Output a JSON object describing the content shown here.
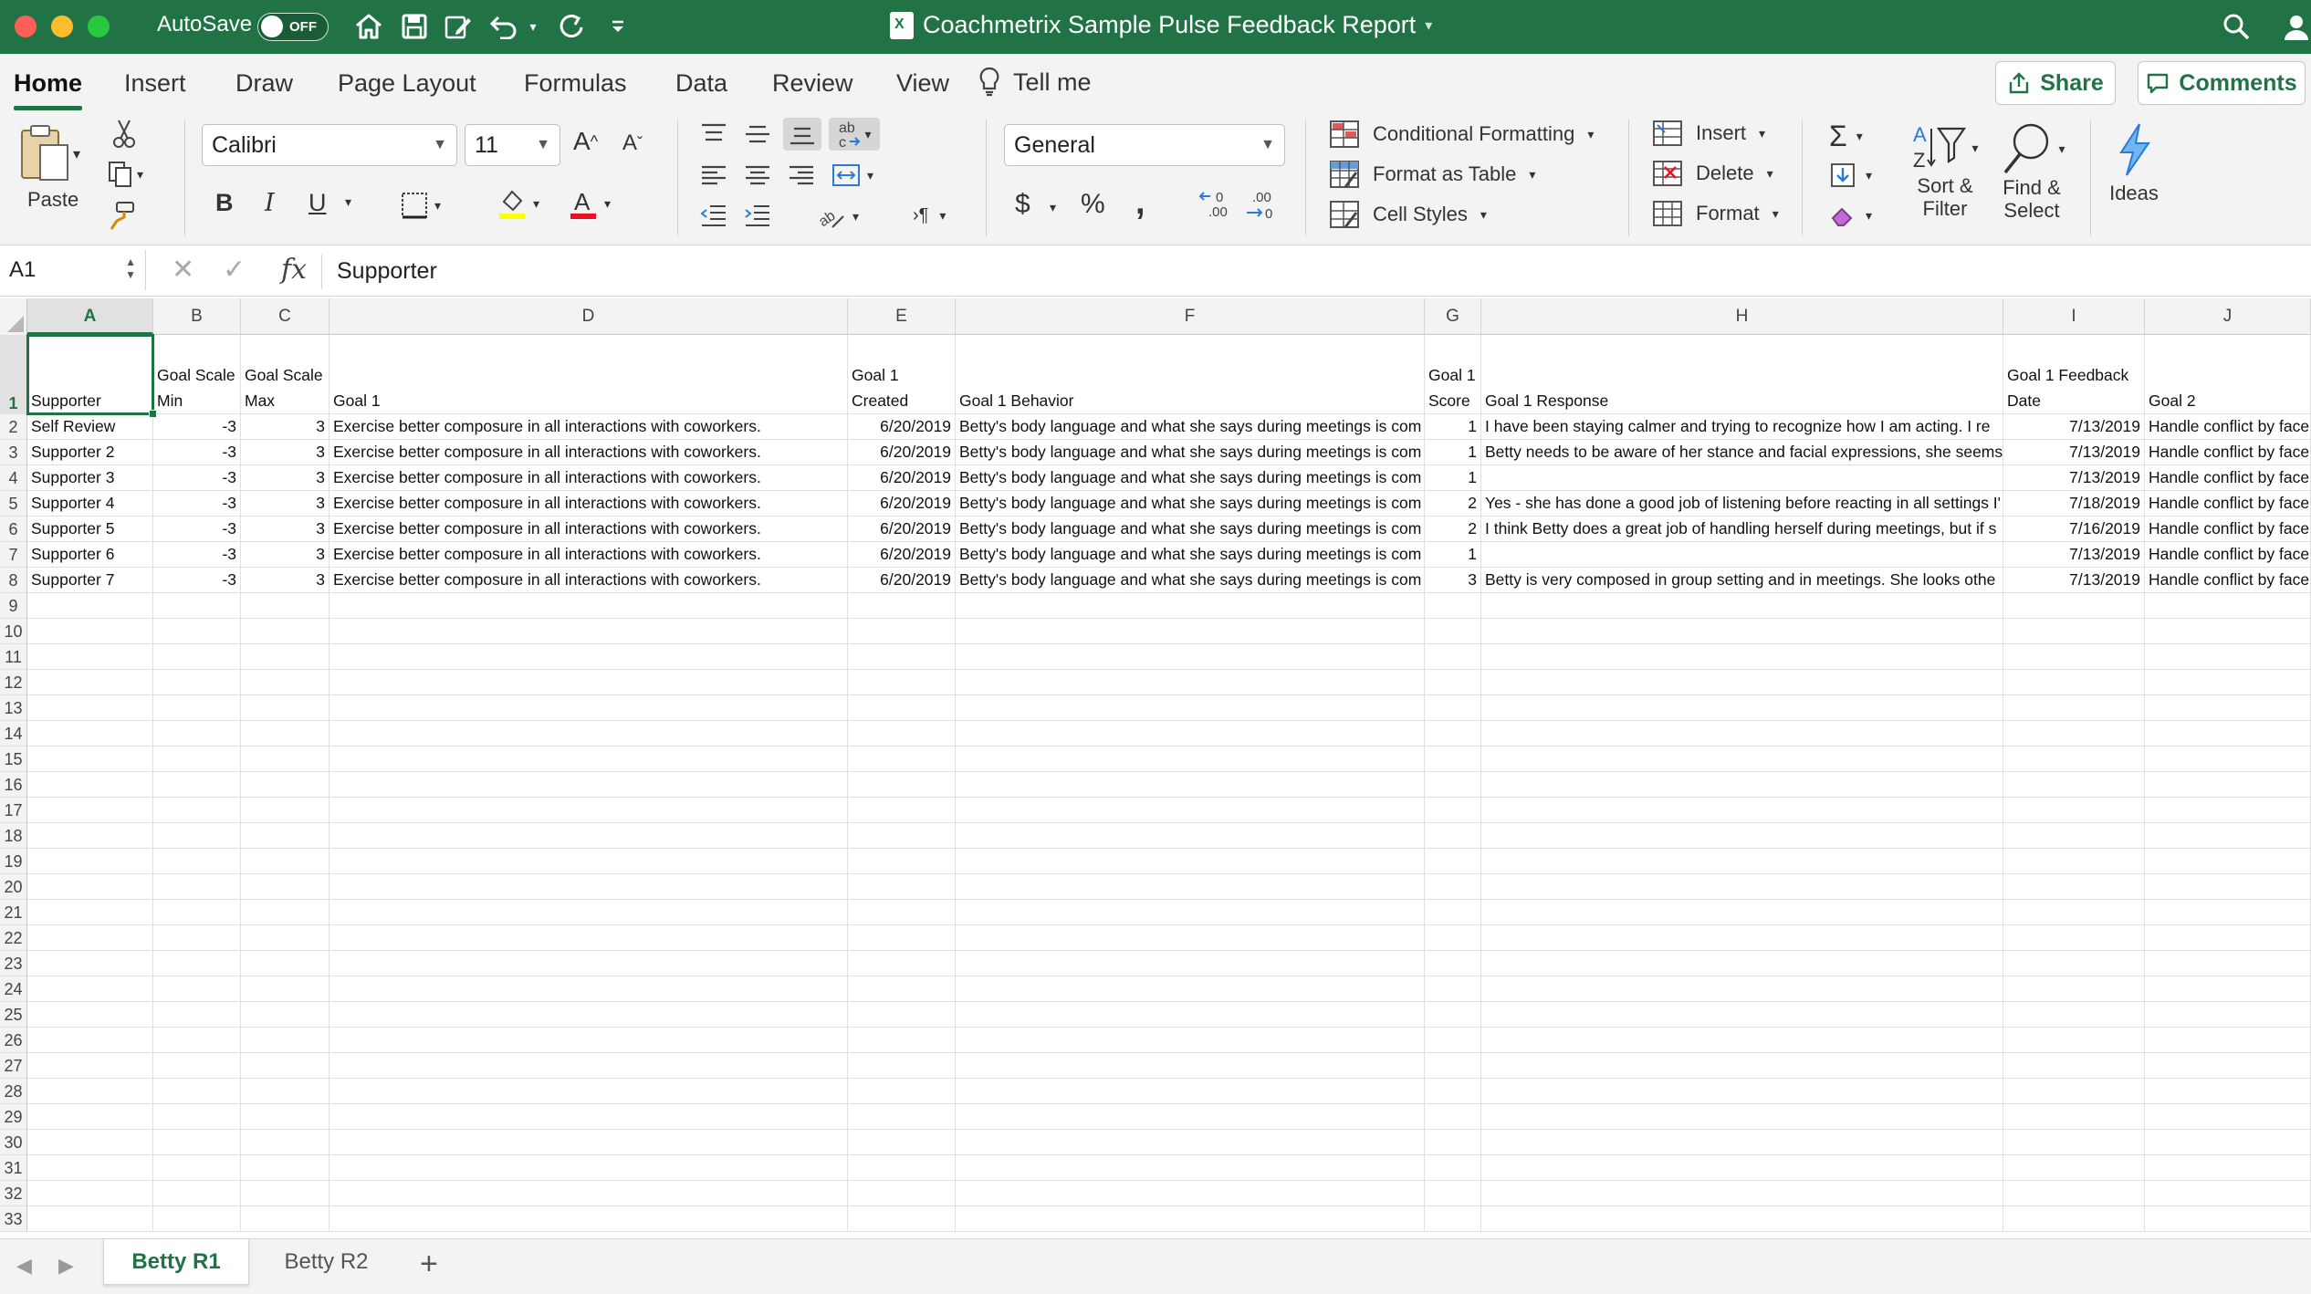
{
  "titlebar": {
    "autosave_label": "AutoSave",
    "autosave_state": "OFF",
    "document_title": "Coachmetrix Sample Pulse Feedback Report"
  },
  "menu": {
    "tabs": [
      "Home",
      "Insert",
      "Draw",
      "Page Layout",
      "Formulas",
      "Data",
      "Review",
      "View"
    ],
    "active_tab": "Home",
    "tell_me": "Tell me",
    "share": "Share",
    "comments": "Comments"
  },
  "ribbon": {
    "paste": "Paste",
    "font_name": "Calibri",
    "font_size": "11",
    "number_format": "General",
    "conditional_formatting": "Conditional Formatting",
    "format_as_table": "Format as Table",
    "cell_styles": "Cell Styles",
    "insert": "Insert",
    "delete": "Delete",
    "format": "Format",
    "sort_filter": "Sort & Filter",
    "find_select": "Find & Select",
    "ideas": "Ideas",
    "bold": "B",
    "italic": "I",
    "underline": "U",
    "currency": "$",
    "percent": "%",
    "comma": ","
  },
  "formula_bar": {
    "name_box": "A1",
    "fx": "fx",
    "value": "Supporter"
  },
  "grid": {
    "columns": [
      "A",
      "B",
      "C",
      "D",
      "E",
      "F",
      "G",
      "H",
      "I",
      "J"
    ],
    "selected_column": "A",
    "selected_row": "1",
    "header_row": [
      "Supporter",
      "Goal Scale Min",
      "Goal Scale Max",
      "Goal 1",
      "Goal 1 Created",
      "Goal 1 Behavior",
      "Goal 1 Score",
      "Goal 1 Response",
      "Goal 1 Feedback Date",
      "Goal 2"
    ],
    "rows": [
      [
        "Self Review",
        "-3",
        "3",
        "Exercise better composure in all interactions with coworkers.",
        "6/20/2019",
        "Betty's body language and what she says during meetings is com",
        "1",
        "I have been staying calmer and trying to recognize how I am acting. I re",
        "7/13/2019",
        "Handle conflict by face"
      ],
      [
        "Supporter 2",
        "-3",
        "3",
        "Exercise better composure in all interactions with coworkers.",
        "6/20/2019",
        "Betty's body language and what she says during meetings is com",
        "1",
        "Betty needs to be aware of her stance and facial expressions, she seems",
        "7/13/2019",
        "Handle conflict by face"
      ],
      [
        "Supporter 3",
        "-3",
        "3",
        "Exercise better composure in all interactions with coworkers.",
        "6/20/2019",
        "Betty's body language and what she says during meetings is com",
        "1",
        "",
        "7/13/2019",
        "Handle conflict by face"
      ],
      [
        "Supporter 4",
        "-3",
        "3",
        "Exercise better composure in all interactions with coworkers.",
        "6/20/2019",
        "Betty's body language and what she says during meetings is com",
        "2",
        "Yes - she has done a good job of listening before reacting in all settings I'",
        "7/18/2019",
        "Handle conflict by face"
      ],
      [
        "Supporter 5",
        "-3",
        "3",
        "Exercise better composure in all interactions with coworkers.",
        "6/20/2019",
        "Betty's body language and what she says during meetings is com",
        "2",
        "I think Betty does a great job of handling herself during meetings, but if s",
        "7/16/2019",
        "Handle conflict by face"
      ],
      [
        "Supporter 6",
        "-3",
        "3",
        "Exercise better composure in all interactions with coworkers.",
        "6/20/2019",
        "Betty's body language and what she says during meetings is com",
        "1",
        "",
        "7/13/2019",
        "Handle conflict by face"
      ],
      [
        "Supporter 7",
        "-3",
        "3",
        "Exercise better composure in all interactions with coworkers.",
        "6/20/2019",
        "Betty's body language and what she says during meetings is com",
        "3",
        "Betty is very composed in group setting and in meetings. She looks othe",
        "7/13/2019",
        "Handle conflict by face"
      ]
    ],
    "row_numbers": [
      "1",
      "2",
      "3",
      "4",
      "5",
      "6",
      "7",
      "8",
      "9",
      "10",
      "11",
      "12",
      "13",
      "14",
      "15",
      "16",
      "17",
      "18",
      "19",
      "20",
      "21",
      "22",
      "23",
      "24",
      "25",
      "26",
      "27",
      "28",
      "29",
      "30",
      "31",
      "32",
      "33"
    ]
  },
  "sheets": {
    "tabs": [
      "Betty R1",
      "Betty R2"
    ],
    "active": "Betty R1",
    "add": "+"
  },
  "colors": {
    "brand": "#217346",
    "titlebar": "#217346",
    "ribbon_bg": "#f3f3f3"
  }
}
